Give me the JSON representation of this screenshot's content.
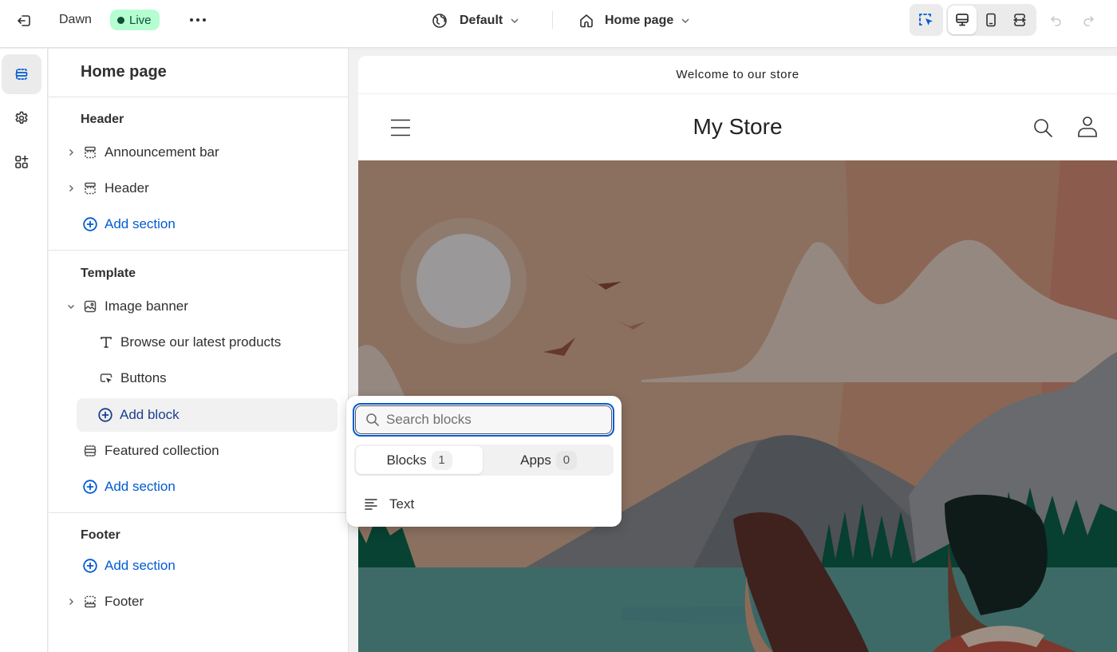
{
  "topbar": {
    "exit_icon": "exit-icon",
    "theme_name": "Dawn",
    "status_badge": "Live",
    "status_color": "#0c5132",
    "status_bg": "#b4fed2",
    "more_icon": "ellipsis-icon",
    "locale_icon": "globe-icon",
    "locale_label": "Default",
    "page_icon": "home-icon",
    "page_label": "Home page",
    "inspect_icon": "select-cursor-icon",
    "viewports": [
      {
        "name": "desktop",
        "icon": "desktop-icon",
        "active": true
      },
      {
        "name": "mobile",
        "icon": "mobile-icon",
        "active": false
      },
      {
        "name": "full-width",
        "icon": "expand-horizontal-icon",
        "active": false
      }
    ],
    "undo_icon": "undo-icon",
    "redo_icon": "redo-icon"
  },
  "rail": {
    "items": [
      {
        "name": "sections",
        "icon": "sections-icon",
        "active": true
      },
      {
        "name": "theme-settings",
        "icon": "gear-icon",
        "active": false
      },
      {
        "name": "app-embeds",
        "icon": "apps-add-icon",
        "active": false
      }
    ]
  },
  "sidebar": {
    "title": "Home page",
    "groups": [
      {
        "title": "Header",
        "items": [
          {
            "label": "Announcement bar",
            "icon": "header-section-icon",
            "expandable": true
          },
          {
            "label": "Header",
            "icon": "header-section-icon",
            "expandable": true
          }
        ],
        "add_label": "Add section"
      },
      {
        "title": "Template",
        "items": [
          {
            "label": "Image banner",
            "icon": "image-section-icon",
            "expanded": true
          },
          {
            "label": "Browse our latest products",
            "icon": "text-block-icon"
          },
          {
            "label": "Buttons",
            "icon": "button-block-icon"
          },
          {
            "label": "Add block",
            "icon": "plus-circle-icon",
            "selected": true
          },
          {
            "label": "Featured collection",
            "icon": "section-icon"
          }
        ],
        "add_label": "Add section"
      },
      {
        "title": "Footer",
        "add_label": "Add section",
        "items": [
          {
            "label": "Footer",
            "icon": "footer-section-icon",
            "expandable": true
          }
        ]
      }
    ]
  },
  "preview": {
    "announcement": "Welcome to our store",
    "store_name": "My Store",
    "menu_icon": "hamburger-icon",
    "search_icon": "search-icon",
    "account_icon": "account-icon"
  },
  "popover": {
    "search_placeholder": "Search blocks",
    "search_value": "",
    "tabs": [
      {
        "label": "Blocks",
        "count": "1",
        "active": true
      },
      {
        "label": "Apps",
        "count": "0",
        "active": false
      }
    ],
    "results": [
      {
        "label": "Text",
        "icon": "text-align-icon"
      }
    ],
    "accent": "#005bd3"
  }
}
